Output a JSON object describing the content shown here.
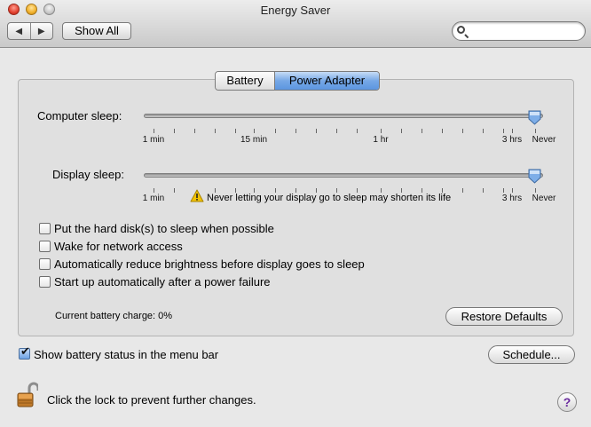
{
  "window": {
    "title": "Energy Saver"
  },
  "toolbar": {
    "back_glyph": "◀",
    "forward_glyph": "▶",
    "show_all": "Show All",
    "search_value": ""
  },
  "tabs": [
    {
      "label": "Battery"
    },
    {
      "label": "Power Adapter",
      "selected": true
    }
  ],
  "computer_sleep": {
    "label": "Computer sleep:",
    "value": "Never",
    "ticks": [
      "1 min",
      "15 min",
      "1 hr",
      "3 hrs",
      "Never"
    ]
  },
  "display_sleep": {
    "label": "Display sleep:",
    "value": "Never",
    "ticks": [
      "1 min",
      "3 hrs",
      "Never"
    ],
    "warning": "Never letting your display go to sleep may shorten its life"
  },
  "options": [
    {
      "label": "Put the hard disk(s) to sleep when possible",
      "checked": false
    },
    {
      "label": "Wake for network access",
      "checked": false
    },
    {
      "label": "Automatically reduce brightness before display goes to sleep",
      "checked": false
    },
    {
      "label": "Start up automatically after a power failure",
      "checked": false
    }
  ],
  "battery_charge": "Current battery charge: 0%",
  "restore_defaults": "Restore Defaults",
  "show_battery_status": {
    "label": "Show battery status in the menu bar",
    "checked": true
  },
  "schedule": "Schedule...",
  "lock_text": "Click the lock to prevent further changes.",
  "help_glyph": "?",
  "colors": {
    "accent": "#5c95e0",
    "help": "#6a2b9e",
    "warning": "#f2c200"
  }
}
